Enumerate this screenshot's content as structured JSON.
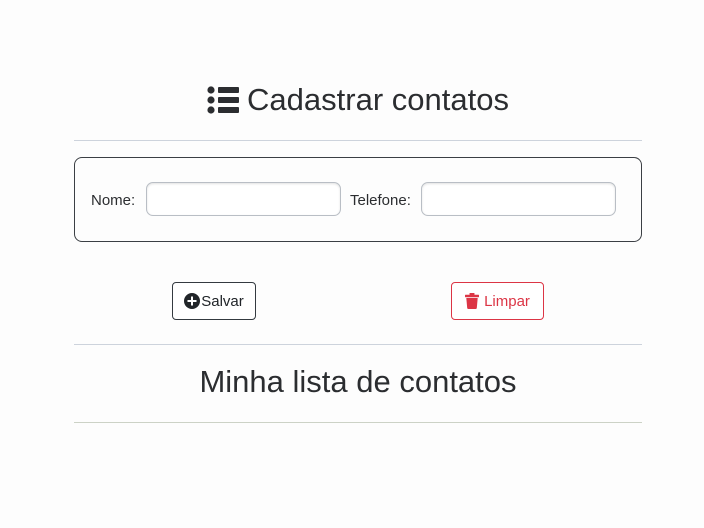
{
  "header": {
    "icon": "list-icon",
    "title": "Cadastrar contatos"
  },
  "form": {
    "name_label": "Nome:",
    "name_value": "",
    "phone_label": "Telefone:",
    "phone_value": ""
  },
  "actions": {
    "save_icon": "plus-circle-icon",
    "save_label": "Salvar",
    "clear_icon": "trash-icon",
    "clear_label": "Limpar"
  },
  "list": {
    "title": "Minha lista de contatos"
  },
  "colors": {
    "danger": "#dc3545",
    "dark": "#343a40",
    "text": "#212529"
  }
}
